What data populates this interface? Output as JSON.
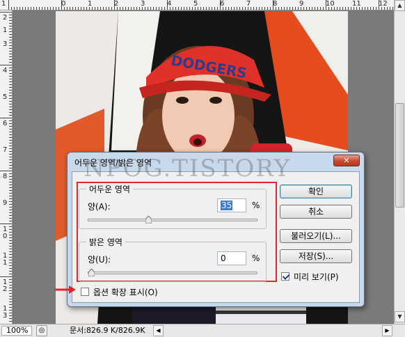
{
  "ruler": {
    "top_labels": [
      "1",
      "0",
      "1",
      "2",
      "3",
      "4",
      "5",
      "6",
      "7",
      "8",
      "9",
      "10",
      "11",
      "12"
    ],
    "left_labels": [
      "2",
      "1",
      "3",
      "4",
      "5",
      "6",
      "7",
      "8",
      "9",
      "1\n0",
      "1\n1",
      "1\n2",
      "1\n3"
    ]
  },
  "canvas": {
    "shirt_text": "DODGERS"
  },
  "watermark": "NPOG.TISTORY",
  "dialog": {
    "title": "어두운 영역/밝은 영역",
    "close_label": "✕",
    "shadows": {
      "legend": "어두운 영역",
      "amount_label": "양(A):",
      "amount_value": "35",
      "unit": "%",
      "slider_percent": 35
    },
    "highlights": {
      "legend": "밝은 영역",
      "amount_label": "양(U):",
      "amount_value": "0",
      "unit": "%",
      "slider_percent": 0
    },
    "show_more_options": {
      "label": "옵션 확장 표시(O)",
      "checked": false
    },
    "buttons": {
      "ok": "확인",
      "cancel": "취소",
      "load": "불러오기(L)...",
      "save": "저장(S)..."
    },
    "preview": {
      "label": "미리 보기(P)",
      "checked": true
    }
  },
  "status": {
    "zoom": "100%",
    "doc_info": "문서:826.9 K/826.9K"
  },
  "colors": {
    "highlight_red": "#e0242c",
    "dialog_frame": "#c9d9ec"
  }
}
